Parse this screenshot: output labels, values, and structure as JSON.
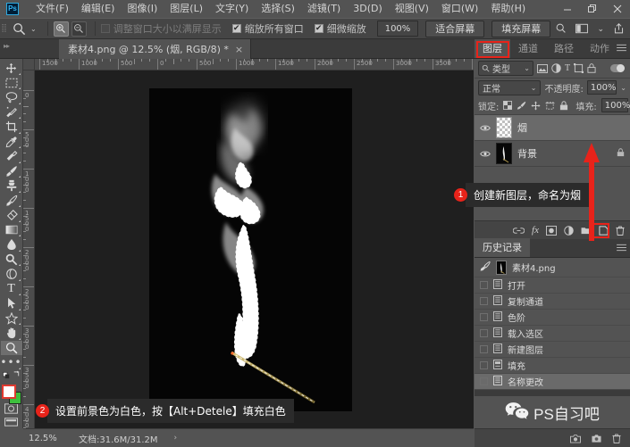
{
  "app": {
    "logo": "Ps",
    "window_buttons": [
      "minimize",
      "restore",
      "close"
    ]
  },
  "menubar": {
    "items": [
      "文件(F)",
      "编辑(E)",
      "图像(I)",
      "图层(L)",
      "文字(Y)",
      "选择(S)",
      "滤镜(T)",
      "3D(D)",
      "视图(V)",
      "窗口(W)",
      "帮助(H)"
    ]
  },
  "options_bar": {
    "tool_icon": "zoom-tool-icon",
    "zoom_in_icon": "zoom-in-icon",
    "zoom_out_icon": "zoom-out-icon",
    "resize_window_label": "调整窗口大小以满屏显示",
    "resize_window_checked": false,
    "zoom_all_windows_label": "缩放所有窗口",
    "zoom_all_windows_checked": true,
    "scrubby_zoom_label": "细微缩放",
    "scrubby_zoom_checked": true,
    "zoom_value": "100%",
    "fit_screen_label": "适合屏幕",
    "fill_screen_label": "填充屏幕",
    "right_icons": [
      "search-icon",
      "workspace-icon",
      "chevron-down-icon",
      "share-icon"
    ]
  },
  "document": {
    "tab_title": "素材4.png @ 12.5% (烟, RGB/8) *",
    "close_glyph": "×"
  },
  "toolbar": {
    "tools": [
      {
        "name": "move-tool",
        "glyph": "move"
      },
      {
        "name": "marquee-tool",
        "glyph": "marquee"
      },
      {
        "name": "lasso-tool",
        "glyph": "lasso"
      },
      {
        "name": "quick-selection-tool",
        "glyph": "quickselect"
      },
      {
        "name": "crop-tool",
        "glyph": "crop"
      },
      {
        "name": "eyedropper-tool",
        "glyph": "eyedropper"
      },
      {
        "name": "healing-brush-tool",
        "glyph": "heal"
      },
      {
        "name": "brush-tool",
        "glyph": "brush"
      },
      {
        "name": "clone-stamp-tool",
        "glyph": "stamp"
      },
      {
        "name": "history-brush-tool",
        "glyph": "historybrush"
      },
      {
        "name": "eraser-tool",
        "glyph": "eraser"
      },
      {
        "name": "gradient-tool",
        "glyph": "gradient"
      },
      {
        "name": "blur-tool",
        "glyph": "blur"
      },
      {
        "name": "dodge-tool",
        "glyph": "dodge"
      },
      {
        "name": "pen-tool",
        "glyph": "pen"
      },
      {
        "name": "type-tool",
        "glyph": "T"
      },
      {
        "name": "path-selection-tool",
        "glyph": "arrow"
      },
      {
        "name": "shape-tool",
        "glyph": "shape"
      },
      {
        "name": "hand-tool",
        "glyph": "hand"
      },
      {
        "name": "zoom-tool",
        "glyph": "zoom",
        "selected": true
      },
      {
        "name": "edit-toolbar-button",
        "glyph": "dots"
      }
    ],
    "foreground_color": "#ffffff",
    "background_color": "#3dbf3d",
    "quick_mask_icon": "quick-mask-icon"
  },
  "rulers": {
    "horizontal_labels": [
      "1500",
      "1000",
      "500",
      "0",
      "500",
      "1000",
      "1500",
      "2000",
      "2500",
      "3000",
      "3500",
      "4C"
    ],
    "vertical_labels": [
      "0",
      "500",
      "1000",
      "1500",
      "2000",
      "2500",
      "3000",
      "3500",
      "4000"
    ]
  },
  "canvas": {
    "image_description": "black background with white smoke plume and incense stick, marching-ants selection around smoke"
  },
  "statusbar": {
    "zoom": "12.5%",
    "doc_info": "文档:31.6M/31.2M",
    "arrow_glyph": "›"
  },
  "panels": {
    "layers": {
      "tabs": [
        {
          "label": "图层",
          "active": true,
          "highlighted": true
        },
        {
          "label": "通道",
          "active": false
        },
        {
          "label": "路径",
          "active": false
        },
        {
          "label": "动作",
          "active": false
        }
      ],
      "menu_icon": "panel-menu-icon",
      "filter": {
        "search_icon": "search-icon",
        "type_label": "类型",
        "chevron": "⌄",
        "icons": [
          "pixel-filter-icon",
          "adjustment-filter-icon",
          "type-filter-icon",
          "shape-filter-icon",
          "smartobject-filter-icon"
        ],
        "toggle_on": true
      },
      "blend_mode": "正常",
      "opacity_label": "不透明度:",
      "opacity_value": "100%",
      "lock_label": "锁定:",
      "lock_icons": [
        "lock-transparent-icon",
        "lock-image-icon",
        "lock-position-icon",
        "lock-artboard-icon",
        "lock-all-icon"
      ],
      "fill_label": "填充:",
      "fill_value": "100%",
      "rows": [
        {
          "name": "烟",
          "visible": true,
          "selected": true,
          "thumb": "transparent",
          "locked": false
        },
        {
          "name": "背景",
          "visible": true,
          "selected": false,
          "thumb": "smoke",
          "locked": true
        }
      ],
      "footer_icons": [
        "link-layers-icon",
        "layer-style-fx-icon",
        "add-mask-icon",
        "adjustment-layer-icon",
        "new-group-icon",
        "new-layer-icon",
        "delete-layer-icon"
      ],
      "new_layer_highlighted": true
    },
    "history": {
      "tab_label": "历史记录",
      "menu_icon": "panel-menu-icon",
      "snapshot": "素材4.png",
      "items": [
        {
          "label": "打开",
          "current": false
        },
        {
          "label": "复制通道",
          "current": false
        },
        {
          "label": "色阶",
          "current": false
        },
        {
          "label": "载入选区",
          "current": false
        },
        {
          "label": "新建图层",
          "current": false
        },
        {
          "label": "填充",
          "current": false
        },
        {
          "label": "名称更改",
          "current": true
        }
      ],
      "footer_icons": [
        "snapshot-icon",
        "new-document-icon",
        "delete-icon"
      ]
    }
  },
  "brand": {
    "icon": "wechat-icon",
    "text": "PS自习吧"
  },
  "callouts": [
    {
      "number": "1",
      "text": "创建新图层，命名为烟"
    },
    {
      "number": "2",
      "text": "设置前景色为白色，按【Alt+Detele】填充白色"
    }
  ],
  "colors": {
    "accent_red": "#e8231a",
    "panel_bg": "#535353",
    "canvas_bg": "#1f1f1f"
  }
}
